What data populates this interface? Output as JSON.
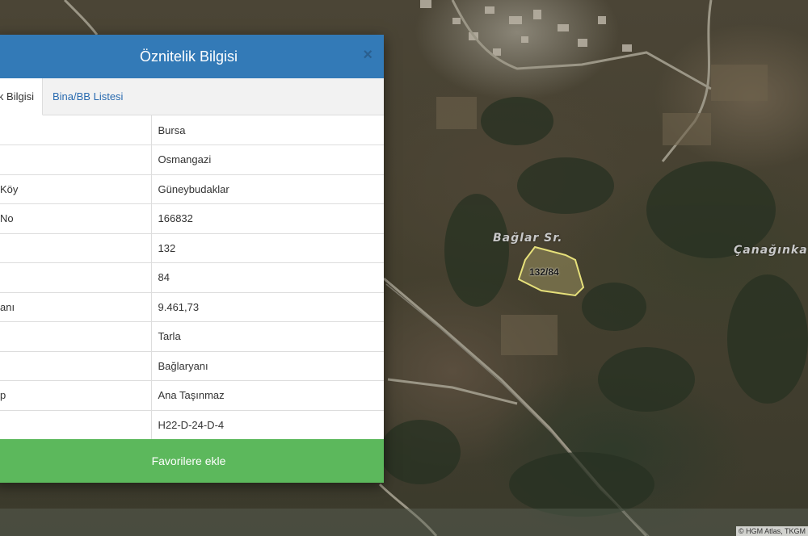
{
  "map": {
    "labels": {
      "street": "Bağlar Sr.",
      "area": "Çanağınka",
      "parcel": "132/84"
    },
    "attribution": "© HGM Atlas, TKGM"
  },
  "dialog": {
    "title": "Öznitelik Bilgisi",
    "close_icon": "×",
    "tabs": [
      {
        "label": "Öznitelik Bilgisi",
        "visible_label": "k Bilgisi",
        "active": true
      },
      {
        "label": "Bina/BB Listesi",
        "active": false
      }
    ],
    "rows": [
      {
        "key": "",
        "value": "Bursa"
      },
      {
        "key": "",
        "value": "Osmangazi"
      },
      {
        "key": "Köy",
        "value": "Güneybudaklar"
      },
      {
        "key": "No",
        "value": "166832"
      },
      {
        "key": "",
        "value": "132"
      },
      {
        "key": "",
        "value": "84"
      },
      {
        "key": "anı",
        "value": "9.461,73"
      },
      {
        "key": "",
        "value": "Tarla"
      },
      {
        "key": "",
        "value": "Bağlaryanı"
      },
      {
        "key": "p",
        "value": "Ana Taşınmaz"
      },
      {
        "key": "",
        "value": "H22-D-24-D-4"
      }
    ],
    "favorite_button": "Favorilere ekle"
  },
  "colors": {
    "header": "#337ab7",
    "button": "#5cb85c",
    "tab_link": "#2a6bb0",
    "parcel_outline": "#e6e07a"
  }
}
